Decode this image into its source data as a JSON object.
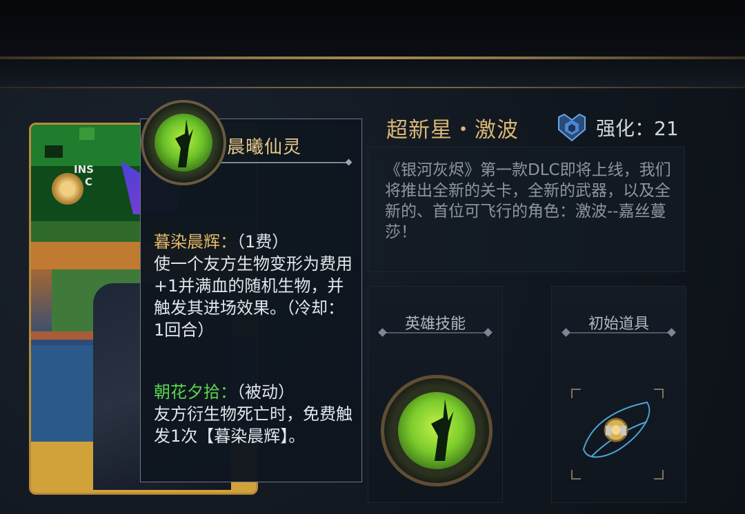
{
  "tooltip": {
    "title": "晨曦仙灵",
    "ability1_name": "暮染晨辉：",
    "ability1_cost": "（1费）",
    "ability1_desc": "使一个友方生物变形为费用+1并满血的随机生物，并触发其进场效果。（冷却：1回合）",
    "ability2_name": "朝花夕拾：",
    "ability2_type": "（被动）",
    "ability2_desc": "友方衍生物死亡时，免费触发1次【暮染晨辉】。"
  },
  "hero": {
    "name": "超新星・激波",
    "rank_label": "强化：21",
    "description": "《银河灰烬》第一款DLC即将上线，我们将推出全新的关卡，全新的武器，以及全新的、首位可飞行的角色：激波--嘉丝蔓莎！"
  },
  "slots": {
    "skill_label": "英雄技能",
    "item_label": "初始道具"
  },
  "card_text": {
    "ins": "INS",
    "c": "C"
  },
  "colors": {
    "gold": "#d9b773",
    "green": "#58d84c",
    "card_border": "#b88a3a"
  },
  "icons": [
    "leaf-icon",
    "rank-shield-icon",
    "hero-skill-orb-icon",
    "starting-item-icon"
  ]
}
